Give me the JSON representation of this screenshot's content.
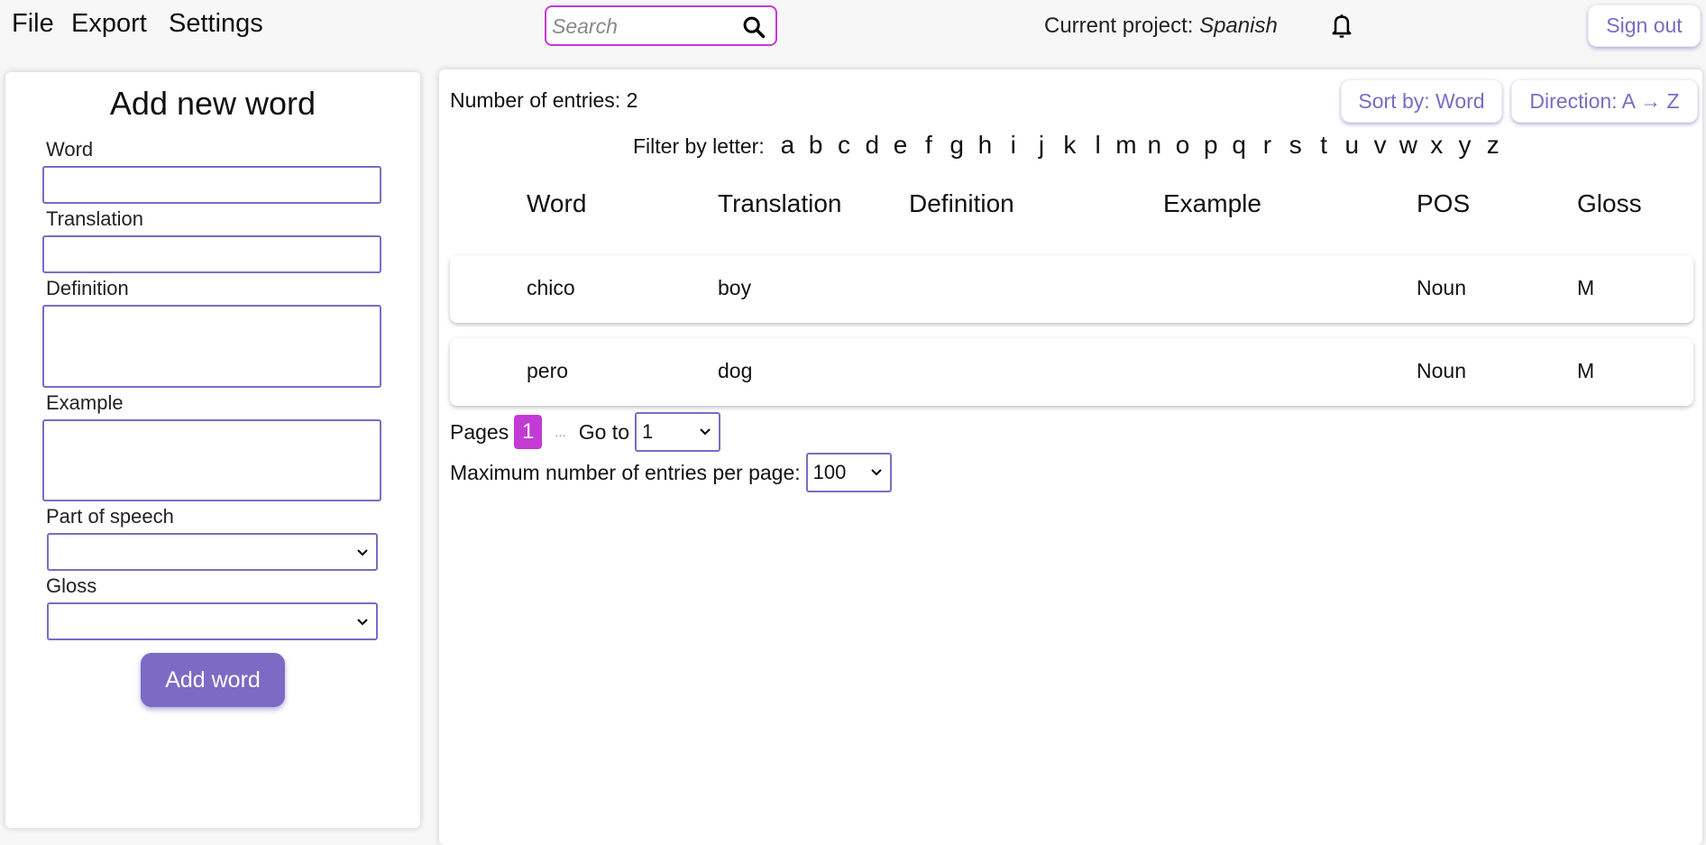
{
  "menu": {
    "file": "File",
    "export": "Export",
    "settings": "Settings"
  },
  "search": {
    "placeholder": "Search",
    "icon": "search-icon"
  },
  "project": {
    "label": "Current project:",
    "name": "Spanish"
  },
  "notifications": {
    "icon": "bell-icon"
  },
  "account": {
    "sign_out": "Sign out"
  },
  "colors": {
    "accent": "#7b6bc4",
    "highlight": "#c23bd4"
  },
  "add_form": {
    "title": "Add new word",
    "fields": {
      "word": {
        "label": "Word",
        "value": ""
      },
      "translation": {
        "label": "Translation",
        "value": ""
      },
      "definition": {
        "label": "Definition",
        "value": ""
      },
      "example": {
        "label": "Example",
        "value": ""
      },
      "pos": {
        "label": "Part of speech",
        "value": ""
      },
      "gloss": {
        "label": "Gloss",
        "value": ""
      }
    },
    "submit": "Add word"
  },
  "list": {
    "count_label": "Number of entries: 2",
    "sort_button": "Sort by: Word",
    "direction_button": "Direction: A → Z",
    "filter_label": "Filter by letter:",
    "letters": [
      "a",
      "b",
      "c",
      "d",
      "e",
      "f",
      "g",
      "h",
      "i",
      "j",
      "k",
      "l",
      "m",
      "n",
      "o",
      "p",
      "q",
      "r",
      "s",
      "t",
      "u",
      "v",
      "w",
      "x",
      "y",
      "z"
    ],
    "columns": [
      "Word",
      "Translation",
      "Definition",
      "Example",
      "POS",
      "Gloss"
    ],
    "rows": [
      {
        "word": "chico",
        "translation": "boy",
        "definition": "",
        "example": "",
        "pos": "Noun",
        "gloss": "M"
      },
      {
        "word": "pero",
        "translation": "dog",
        "definition": "",
        "example": "",
        "pos": "Noun",
        "gloss": "M"
      }
    ],
    "pagination": {
      "pages_label": "Pages",
      "current_page": "1",
      "ellipsis": "...",
      "goto_label": "Go to",
      "goto_value": "1",
      "max_label": "Maximum number of entries per page:",
      "max_value": "100"
    }
  }
}
